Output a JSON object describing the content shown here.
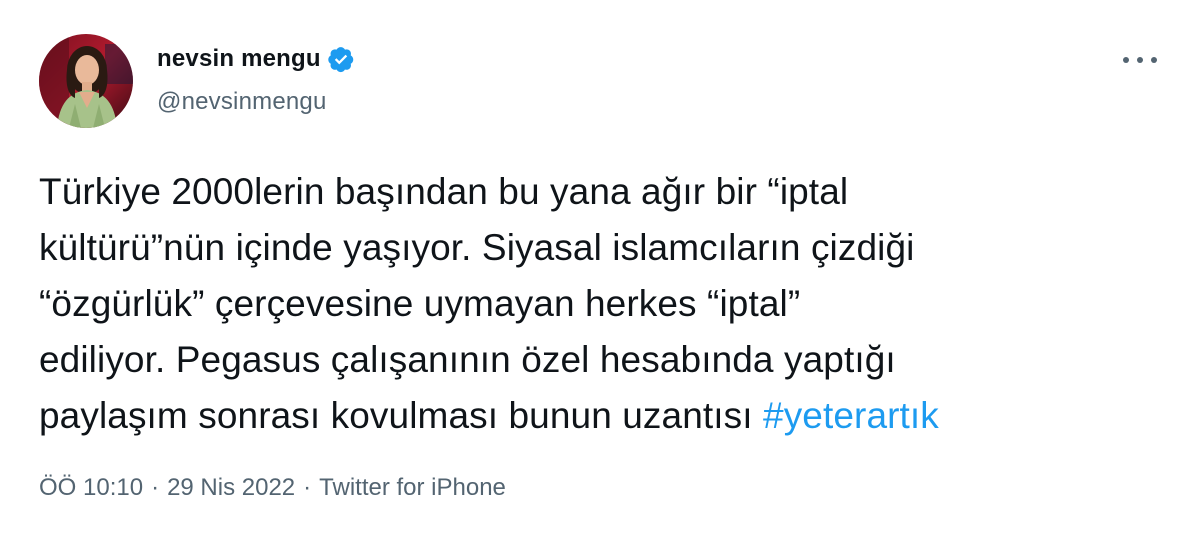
{
  "author": {
    "display_name": "nevsin mengu",
    "handle": "@nevsinmengu",
    "verified": true,
    "avatar_icon": "profile-photo"
  },
  "tweet": {
    "lines": [
      "Türkiye 2000lerin başından bu yana ağır bir “iptal",
      "kültürü”nün içinde yaşıyor. Siyasal islamcıların çizdiği",
      "“özgürlük” çerçevesine uymayan herkes “iptal”",
      "ediliyor. Pegasus çalışanının özel hesabında yaptığı",
      "paylaşım sonrası kovulması bunun uzantısı "
    ],
    "hashtag": "#yeterartık"
  },
  "meta": {
    "time": "ÖÖ 10:10",
    "separator": "·",
    "date": "29 Nis 2022",
    "source": "Twitter for iPhone"
  },
  "colors": {
    "text": "#0f1419",
    "secondary": "#536471",
    "link": "#1d9bf0",
    "verified": "#1d9bf0"
  },
  "icons": {
    "more": "more-horizontal-icon",
    "verified": "verified-badge-icon"
  }
}
